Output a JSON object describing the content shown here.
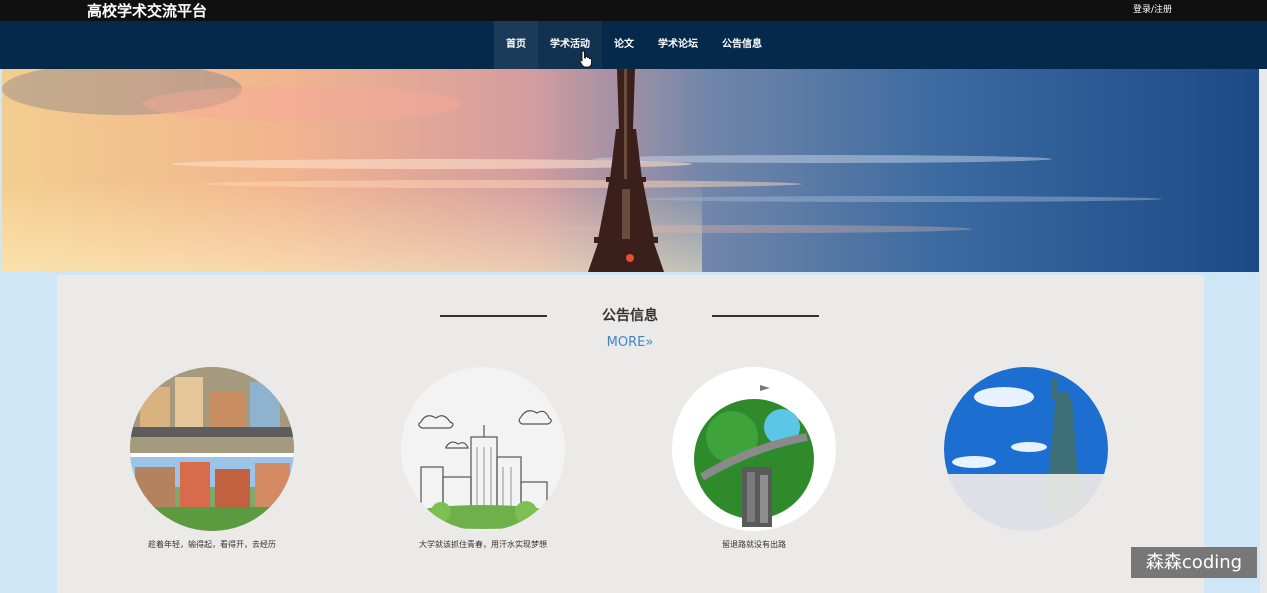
{
  "header": {
    "title": "高校学术交流平台",
    "login_label": "登录/注册"
  },
  "nav": {
    "items": [
      {
        "label": "首页",
        "active": true
      },
      {
        "label": "学术活动",
        "hover": true
      },
      {
        "label": "论文"
      },
      {
        "label": "学术论坛"
      },
      {
        "label": "公告信息"
      }
    ]
  },
  "section": {
    "title": "公告信息",
    "more_label": "MORE»"
  },
  "notices": [
    {
      "caption": "趁着年轻，输得起，看得开，去经历"
    },
    {
      "caption": "大学就该抓住青春，用汗水实现梦想"
    },
    {
      "caption": "留退路就没有出路"
    },
    {
      "caption": ""
    }
  ],
  "watermark": {
    "text": "森森coding"
  },
  "colors": {
    "topbar": "#101010",
    "navbar": "#05294a",
    "accent": "#3f86c8",
    "page_bg": "#cfe6f6"
  }
}
